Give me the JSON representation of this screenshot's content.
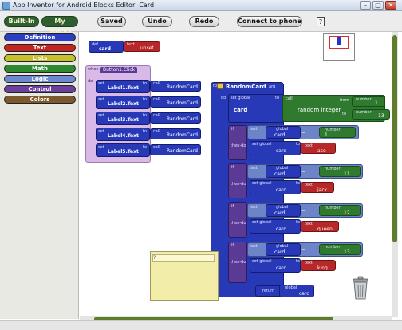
{
  "window": {
    "title": "App Inventor for Android Blocks Editor: Card"
  },
  "window_controls": {
    "minimize": "–",
    "maximize": "□",
    "close": "✕"
  },
  "tabs": [
    {
      "label": "Built-In"
    },
    {
      "label": "My Blocks"
    }
  ],
  "toolbar": {
    "saved": "Saved",
    "undo": "Undo",
    "redo": "Redo",
    "connect": "Connect to phone",
    "help": "?"
  },
  "drawers": [
    {
      "label": "Definition",
      "color": "#2c3fc4"
    },
    {
      "label": "Text",
      "color": "#c4231f"
    },
    {
      "label": "Lists",
      "color": "#c6c02a"
    },
    {
      "label": "Math",
      "color": "#2f8a2f"
    },
    {
      "label": "Logic",
      "color": "#6d89cf"
    },
    {
      "label": "Control",
      "color": "#6d3f9d"
    },
    {
      "label": "Colors",
      "color": "#7c5a2e"
    }
  ],
  "blocks": {
    "def": {
      "keyword": "def",
      "name": "card",
      "text_kw": "text",
      "value": "unset"
    },
    "when": {
      "keyword": "when",
      "event": "Button1.Click",
      "do": "do"
    },
    "labels": [
      {
        "set": "set",
        "target": "Label1.Text",
        "to": "to",
        "call": "call",
        "proc": "RandomCard"
      },
      {
        "set": "set",
        "target": "Label2.Text",
        "to": "to",
        "call": "call",
        "proc": "RandomCard"
      },
      {
        "set": "set",
        "target": "Label3.Text",
        "to": "to",
        "call": "call",
        "proc": "RandomCard"
      },
      {
        "set": "set",
        "target": "Label4.Text",
        "to": "to",
        "call": "call",
        "proc": "RandomCard"
      },
      {
        "set": "set",
        "target": "Label5.Text",
        "to": "to",
        "call": "call",
        "proc": "RandomCard"
      }
    ],
    "proc": {
      "to": "to",
      "name": "RandomCard",
      "arg": "arg",
      "do": "do",
      "setglobal": "set global",
      "var": "card",
      "to_kw": "to",
      "call": "call",
      "fn": "random integer",
      "from": "from",
      "from_val": "1",
      "to_lbl": "to",
      "to_val": "13",
      "ret": "return",
      "ret_global": "global",
      "ret_var": "card"
    },
    "ifs": [
      {
        "if": "if",
        "test": "test",
        "global": "global",
        "var": "card",
        "op": "=",
        "number_kw": "number",
        "number": "1",
        "then": "then-do",
        "setglobal": "set global",
        "setvar": "card",
        "to": "to",
        "text_kw": "text",
        "text": "ace"
      },
      {
        "if": "if",
        "test": "test",
        "global": "global",
        "var": "card",
        "op": "=",
        "number_kw": "number",
        "number": "11",
        "then": "then-do",
        "setglobal": "set global",
        "setvar": "card",
        "to": "to",
        "text_kw": "text",
        "text": "jack"
      },
      {
        "if": "if",
        "test": "test",
        "global": "global",
        "var": "card",
        "op": "=",
        "number_kw": "number",
        "number": "12",
        "then": "then-do",
        "setglobal": "set global",
        "setvar": "card",
        "to": "to",
        "text_kw": "text",
        "text": "queen"
      },
      {
        "if": "if",
        "test": "test",
        "global": "global",
        "var": "card",
        "op": "=",
        "number_kw": "number",
        "number": "13",
        "then": "then-do",
        "setglobal": "set global",
        "setvar": "card",
        "to": "to",
        "text_kw": "text",
        "text": "king"
      }
    ]
  },
  "note": {
    "text": "?"
  }
}
